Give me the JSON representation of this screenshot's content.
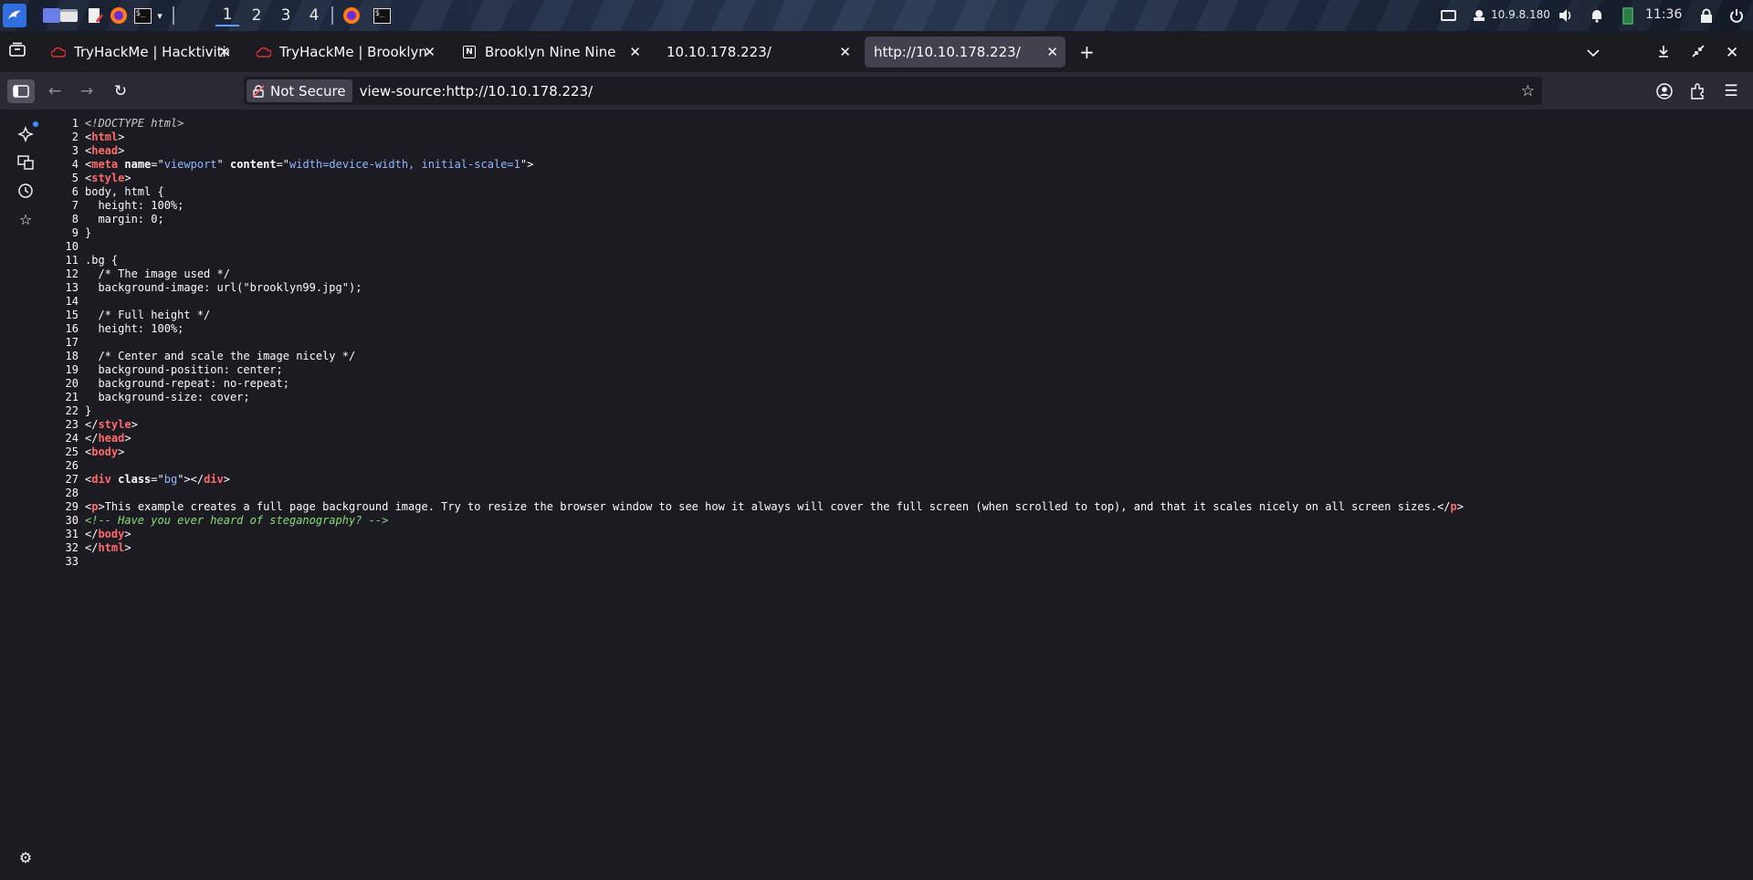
{
  "panel": {
    "workspaces": [
      "1",
      "2",
      "3",
      "4"
    ],
    "active_workspace": "1",
    "ip": "10.9.8.180",
    "clock": "11:36",
    "icons": [
      "kali-menu-icon",
      "desktop-icon",
      "files-icon",
      "text-editor-icon",
      "firefox-icon",
      "terminal-icon",
      "chevron-down-icon"
    ]
  },
  "tabs": [
    {
      "title": "TryHackMe | Hacktivities",
      "icon": "tryhackme-icon"
    },
    {
      "title": "TryHackMe | Brooklyn Nine Nine",
      "icon": "tryhackme-icon"
    },
    {
      "title": "Brooklyn Nine Nine",
      "icon": "notion-icon"
    },
    {
      "title": "10.10.178.223/",
      "icon": ""
    },
    {
      "title": "http://10.10.178.223/",
      "icon": "",
      "active": true
    }
  ],
  "navbar": {
    "security_label": "Not Secure",
    "url": "view-source:http://10.10.178.223/"
  },
  "source": {
    "line_count": 33,
    "lines": [
      [
        [
          "dt",
          "<!DOCTYPE html>"
        ]
      ],
      [
        [
          "p",
          "<"
        ],
        [
          "tag",
          "html"
        ],
        [
          "p",
          ">"
        ]
      ],
      [
        [
          "p",
          "<"
        ],
        [
          "tag",
          "head"
        ],
        [
          "p",
          ">"
        ]
      ],
      [
        [
          "p",
          "<"
        ],
        [
          "tag",
          "meta"
        ],
        [
          "p",
          " "
        ],
        [
          "attr",
          "name"
        ],
        [
          "p",
          "=\""
        ],
        [
          "val",
          "viewport"
        ],
        [
          "p",
          "\" "
        ],
        [
          "attr",
          "content"
        ],
        [
          "p",
          "=\""
        ],
        [
          "val",
          "width=device-width, initial-scale=1"
        ],
        [
          "p",
          "\">"
        ]
      ],
      [
        [
          "p",
          "<"
        ],
        [
          "tag",
          "style"
        ],
        [
          "p",
          ">"
        ]
      ],
      [
        [
          "p",
          "body, html {"
        ]
      ],
      [
        [
          "p",
          "  height: 100%;"
        ]
      ],
      [
        [
          "p",
          "  margin: 0;"
        ]
      ],
      [
        [
          "p",
          "}"
        ]
      ],
      [
        [
          "p",
          ""
        ]
      ],
      [
        [
          "p",
          ".bg {"
        ]
      ],
      [
        [
          "p",
          "  /* The image used */"
        ]
      ],
      [
        [
          "p",
          "  background-image: url(\"brooklyn99.jpg\");"
        ]
      ],
      [
        [
          "p",
          ""
        ]
      ],
      [
        [
          "p",
          "  /* Full height */"
        ]
      ],
      [
        [
          "p",
          "  height: 100%;"
        ]
      ],
      [
        [
          "p",
          ""
        ]
      ],
      [
        [
          "p",
          "  /* Center and scale the image nicely */"
        ]
      ],
      [
        [
          "p",
          "  background-position: center;"
        ]
      ],
      [
        [
          "p",
          "  background-repeat: no-repeat;"
        ]
      ],
      [
        [
          "p",
          "  background-size: cover;"
        ]
      ],
      [
        [
          "p",
          "}"
        ]
      ],
      [
        [
          "p",
          "</"
        ],
        [
          "tag",
          "style"
        ],
        [
          "p",
          ">"
        ]
      ],
      [
        [
          "p",
          "</"
        ],
        [
          "tag",
          "head"
        ],
        [
          "p",
          ">"
        ]
      ],
      [
        [
          "p",
          "<"
        ],
        [
          "tag",
          "body"
        ],
        [
          "p",
          ">"
        ]
      ],
      [
        [
          "p",
          ""
        ]
      ],
      [
        [
          "p",
          "<"
        ],
        [
          "tag",
          "div"
        ],
        [
          "p",
          " "
        ],
        [
          "attr",
          "class"
        ],
        [
          "p",
          "=\""
        ],
        [
          "val",
          "bg"
        ],
        [
          "p",
          "\"></"
        ],
        [
          "tag",
          "div"
        ],
        [
          "p",
          ">"
        ]
      ],
      [
        [
          "p",
          ""
        ]
      ],
      [
        [
          "p",
          "<"
        ],
        [
          "tag",
          "p"
        ],
        [
          "p",
          ">This example creates a full page background image. Try to resize the browser window to see how it always will cover the full screen (when scrolled to top), and that it scales nicely on all screen sizes.</"
        ],
        [
          "tag",
          "p"
        ],
        [
          "p",
          ">"
        ]
      ],
      [
        [
          "cmt",
          "<!-- Have you ever heard of steganography? -->"
        ]
      ],
      [
        [
          "p",
          "</"
        ],
        [
          "tag",
          "body"
        ],
        [
          "p",
          ">"
        ]
      ],
      [
        [
          "p",
          "</"
        ],
        [
          "tag",
          "html"
        ],
        [
          "p",
          ">"
        ]
      ],
      [
        [
          "p",
          ""
        ]
      ]
    ]
  },
  "colors": {
    "tag": "#ff6b6b",
    "attr_value": "#8fb7ff",
    "comment": "#86de74",
    "tab_active_bg": "#42414d",
    "chrome_bg": "#1c1b22",
    "navbar_bg": "#2b2a33"
  }
}
